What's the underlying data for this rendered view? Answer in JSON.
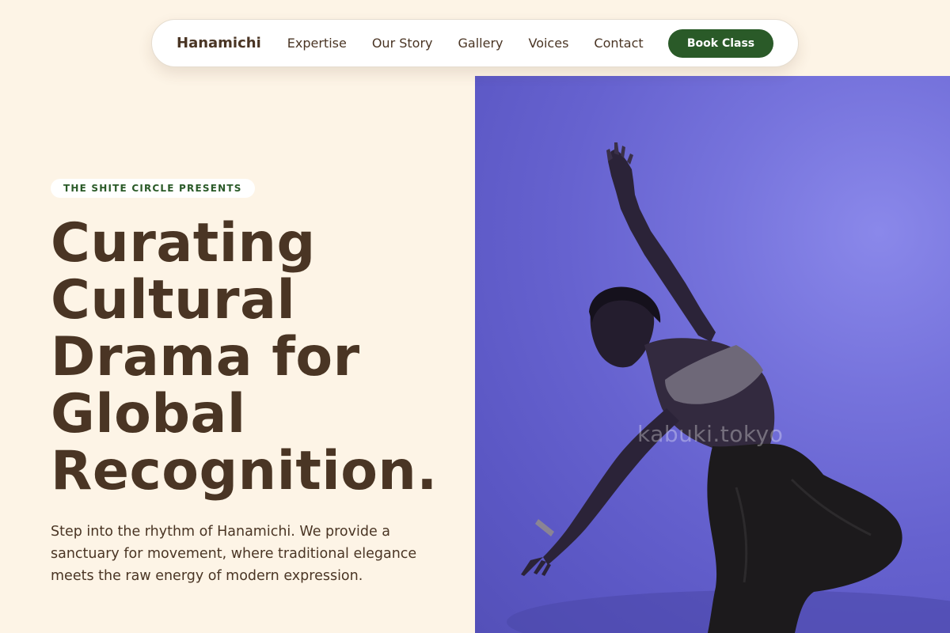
{
  "nav": {
    "brand": "Hanamichi",
    "links": [
      "Expertise",
      "Our Story",
      "Gallery",
      "Voices",
      "Contact"
    ],
    "cta": "Book Class"
  },
  "hero": {
    "eyebrow": "THE SHITE CIRCLE PRESENTS",
    "headline_lines": [
      "Curating",
      "Cultural",
      "Drama for",
      "Global",
      "Recognition."
    ],
    "lede": "Step into the rhythm of Hanamichi. We provide a sanctuary for movement, where traditional elegance meets the raw energy of modern expression.",
    "image": {
      "description_icon": "dancer-photo",
      "watermark": "kabuki.tokyo"
    }
  },
  "colors": {
    "background": "#fdf4e6",
    "text": "#4a3524",
    "accent_green": "#2a5a28",
    "photo_backdrop": "#6662cf"
  }
}
